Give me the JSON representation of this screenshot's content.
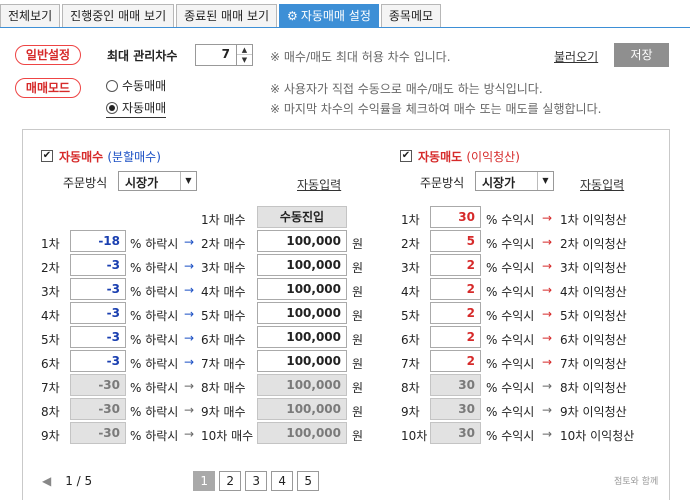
{
  "tabs": [
    {
      "label": "전체보기",
      "active": false
    },
    {
      "label": "진행중인 매매 보기",
      "active": false
    },
    {
      "label": "종료된 매매 보기",
      "active": false
    },
    {
      "label": "자동매매 설정",
      "active": true,
      "icon": "gear-icon"
    },
    {
      "label": "종목메모",
      "active": false
    }
  ],
  "general": {
    "pill_label": "일반설정",
    "max_label": "최대 관리차수",
    "max_value": "7",
    "max_note": "※ 매수/매도 최대 허용 차수 입니다.",
    "load_link": "불러오기",
    "save_label": "저장"
  },
  "mode": {
    "pill_label": "매매모드",
    "option_manual": "수동매매",
    "option_auto": "자동매매",
    "note_manual": "※ 사용자가 직접 수동으로 매수/매도 하는 방식입니다.",
    "note_auto": "※ 마지막 차수의 수익률을 체크하여 매수 또는 매도를 실행합니다."
  },
  "buy": {
    "title": "자동매수",
    "subtitle": "(분할매수)",
    "order_label": "주문방식",
    "order_value": "시장가",
    "auto_input": "자동입력",
    "first_label": "1차 매수",
    "first_value": "수동진입",
    "unit_pct": "% 하락시",
    "unit_won": "원",
    "rows": [
      {
        "step": "1차",
        "pct": "-18",
        "target": "2차 매수",
        "amount": "100,000",
        "enabled": true
      },
      {
        "step": "2차",
        "pct": "-3",
        "target": "3차 매수",
        "amount": "100,000",
        "enabled": true
      },
      {
        "step": "3차",
        "pct": "-3",
        "target": "4차 매수",
        "amount": "100,000",
        "enabled": true
      },
      {
        "step": "4차",
        "pct": "-3",
        "target": "5차 매수",
        "amount": "100,000",
        "enabled": true
      },
      {
        "step": "5차",
        "pct": "-3",
        "target": "6차 매수",
        "amount": "100,000",
        "enabled": true
      },
      {
        "step": "6차",
        "pct": "-3",
        "target": "7차 매수",
        "amount": "100,000",
        "enabled": true
      },
      {
        "step": "7차",
        "pct": "-30",
        "target": "8차 매수",
        "amount": "100,000",
        "enabled": false
      },
      {
        "step": "8차",
        "pct": "-30",
        "target": "9차 매수",
        "amount": "100,000",
        "enabled": false
      },
      {
        "step": "9차",
        "pct": "-30",
        "target": "10차 매수",
        "amount": "100,000",
        "enabled": false
      }
    ]
  },
  "sell": {
    "title": "자동매도",
    "subtitle": "(이익청산)",
    "order_label": "주문방식",
    "order_value": "시장가",
    "auto_input": "자동입력",
    "unit_pct": "% 수익시",
    "rows": [
      {
        "step": "1차",
        "pct": "30",
        "target": "1차 이익청산",
        "enabled": true
      },
      {
        "step": "2차",
        "pct": "5",
        "target": "2차 이익청산",
        "enabled": true
      },
      {
        "step": "3차",
        "pct": "2",
        "target": "3차 이익청산",
        "enabled": true
      },
      {
        "step": "4차",
        "pct": "2",
        "target": "4차 이익청산",
        "enabled": true
      },
      {
        "step": "5차",
        "pct": "2",
        "target": "5차 이익청산",
        "enabled": true
      },
      {
        "step": "6차",
        "pct": "2",
        "target": "6차 이익청산",
        "enabled": true
      },
      {
        "step": "7차",
        "pct": "2",
        "target": "7차 이익청산",
        "enabled": true
      },
      {
        "step": "8차",
        "pct": "30",
        "target": "8차 이익청산",
        "enabled": false
      },
      {
        "step": "9차",
        "pct": "30",
        "target": "9차 이익청산",
        "enabled": false
      },
      {
        "step": "10차",
        "pct": "30",
        "target": "10차 이익청산",
        "enabled": false
      }
    ]
  },
  "pager": {
    "info": "1 / 5",
    "pages": [
      "1",
      "2",
      "3",
      "4",
      "5"
    ],
    "current": "1"
  },
  "watermark": "점토와 함께"
}
